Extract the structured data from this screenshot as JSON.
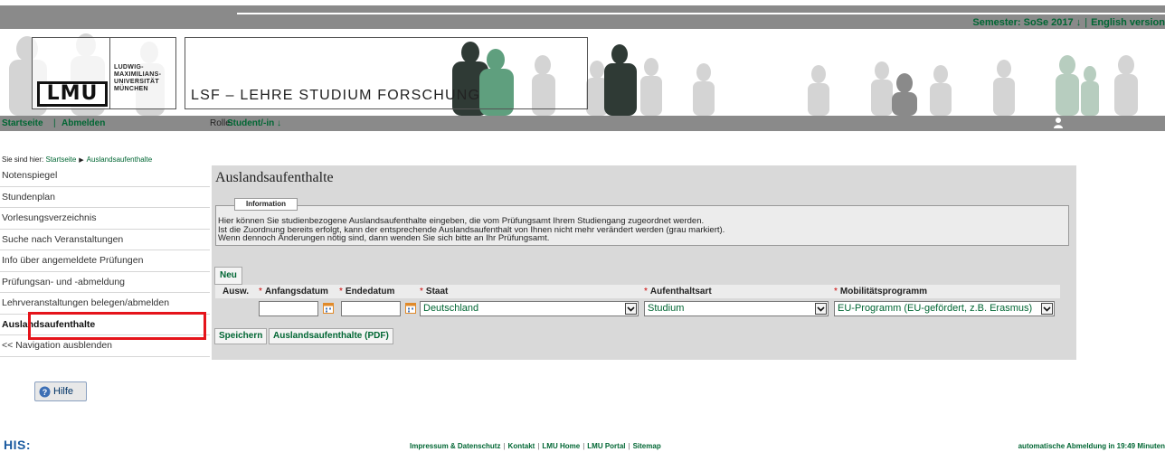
{
  "topbar": {
    "semester_label": "Semester: SoSe 2017 ↓",
    "separator": "|",
    "language_link": "English version"
  },
  "header": {
    "logo_mark": "LMU",
    "logo_text_lines": [
      "LUDWIG-",
      "MAXIMILIANS-",
      "UNIVERSITÄT",
      "MÜNCHEN"
    ],
    "system_title": "LSF – LEHRE STUDIUM FORSCHUNG"
  },
  "navbar": {
    "home": "Startseite",
    "separator": "|",
    "logout": "Abmelden",
    "role_label": "Rolle:",
    "role_value": "Student/-in ↓"
  },
  "breadcrumb": {
    "prefix": "Sie sind hier:",
    "home": "Startseite",
    "current": "Auslandsaufenthalte"
  },
  "sidebar": {
    "items": [
      {
        "label": "Notenspiegel"
      },
      {
        "label": "Stundenplan"
      },
      {
        "label": "Vorlesungsverzeichnis"
      },
      {
        "label": "Suche nach Veranstaltungen"
      },
      {
        "label": "Info über angemeldete Prüfungen"
      },
      {
        "label": "Prüfungsan- und -abmeldung"
      },
      {
        "label": "Lehrveranstaltungen belegen/abmelden"
      },
      {
        "label": "Auslandsaufenthalte"
      },
      {
        "label": "<< Navigation ausblenden"
      }
    ]
  },
  "main": {
    "title": "Auslandsaufenthalte",
    "info": {
      "legend": "Information",
      "lines": [
        "Hier können Sie studienbezogene Auslandsaufenthalte eingeben, die vom Prüfungsamt Ihrem Studiengang zugeordnet werden.",
        "Ist die Zuordnung bereits erfolgt, kann der entsprechende Auslandsaufenthalt von Ihnen nicht mehr verändert werden (grau markiert).",
        "Wenn dennoch Änderungen nötig sind, dann wenden Sie sich bitte an Ihr Prüfungsamt."
      ]
    },
    "new_button": "Neu",
    "table": {
      "headers": {
        "select": "Ausw.",
        "required_marker": "*",
        "start_date": "Anfangsdatum",
        "end_date": "Endedatum",
        "country": "Staat",
        "stay_type": "Aufenthaltsart",
        "mobility_program": "Mobilitätsprogramm"
      },
      "row": {
        "start_date": "",
        "end_date": "",
        "country": "Deutschland",
        "stay_type": "Studium",
        "mobility_program": "EU-Programm (EU-gefördert, z.B. Erasmus)"
      }
    },
    "save_button": "Speichern",
    "pdf_button": "Auslandsaufenthalte (PDF)"
  },
  "help_button": "Hilfe",
  "footer": {
    "his_logo": "HIS:",
    "links": [
      "Impressum & Datenschutz",
      "Kontakt",
      "LMU Home",
      "LMU Portal",
      "Sitemap"
    ],
    "link_separator": "|",
    "auto_logout": "automatische Abmeldung in 19:49 Minuten"
  },
  "colors": {
    "accent_green": "#006633",
    "bar_gray": "#8a8a8a",
    "panel_gray": "#d9d9d9",
    "highlight_red": "#e5141b"
  }
}
